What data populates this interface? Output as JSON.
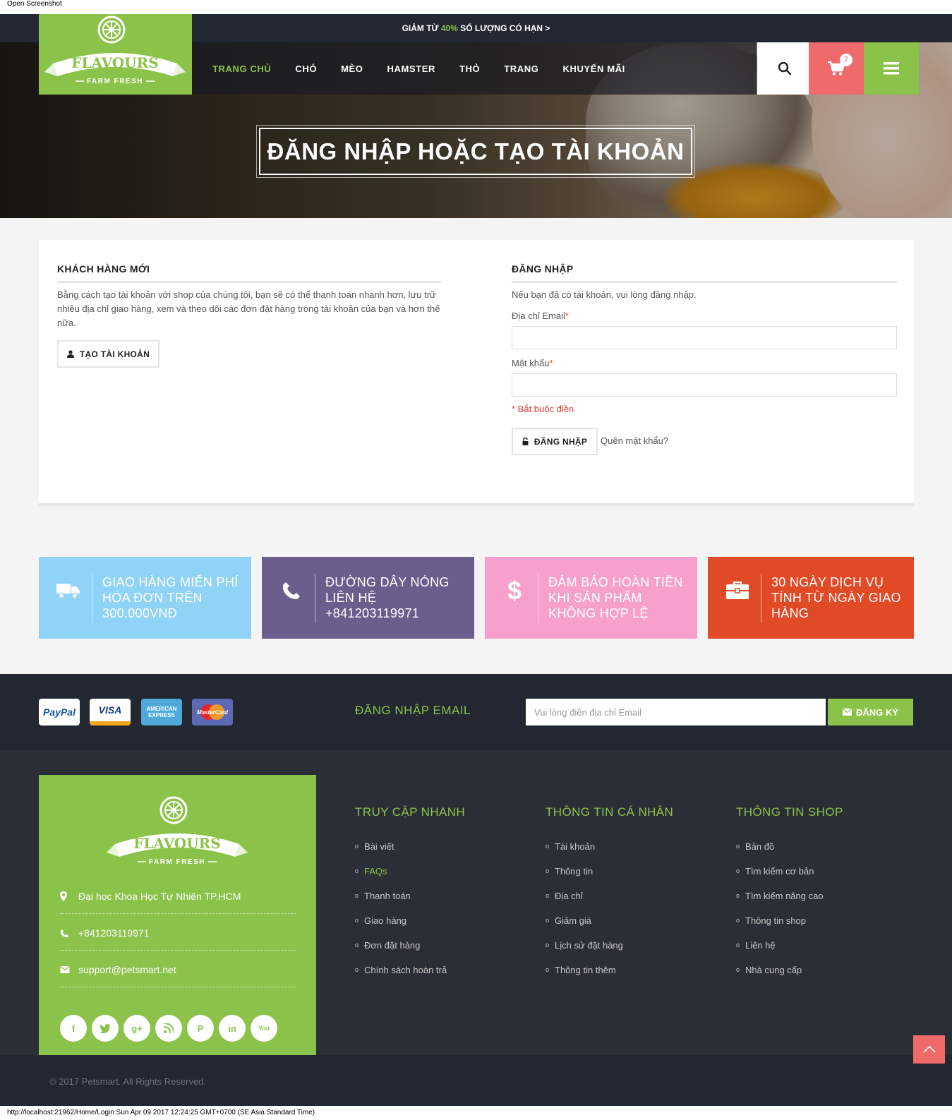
{
  "window": {
    "label": "Open Screenshot"
  },
  "promo": {
    "prefix": "GIẢM TỪ ",
    "highlight": "40%",
    "suffix": " SỐ LƯỢNG CÓ HẠN >"
  },
  "logo": {
    "brand": "FLAVOURS",
    "tagline": "FARM FRESH"
  },
  "nav": {
    "items": [
      {
        "label": "TRANG CHỦ",
        "active": true
      },
      {
        "label": "CHÓ"
      },
      {
        "label": "MÈO"
      },
      {
        "label": "HAMSTER"
      },
      {
        "label": "THỎ"
      },
      {
        "label": "TRANG"
      },
      {
        "label": "KHUYẾN MÃI"
      }
    ]
  },
  "cart": {
    "count": "2"
  },
  "hero": {
    "title": "ĐĂNG NHẬP HOẶC TẠO TÀI KHOẢN"
  },
  "new_customer": {
    "title": "KHÁCH HÀNG MỚI",
    "description": "Bằng cách tạo tài khoản với shop của chúng tôi, bạn sẽ có thể thanh toán nhanh hơn, lưu trữ nhiều địa chỉ giao hàng, xem và theo dõi các đơn đặt hàng trong tài khoản của bạn và hơn thế nữa.",
    "button": "TẠO TÀI KHOẢN"
  },
  "login": {
    "title": "ĐĂNG NHẬP",
    "intro": "Nếu bạn đã có tài khoản, vui lòng đăng nhập.",
    "email_label": "Địa chỉ Email",
    "email_value": "",
    "password_label": "Mật khẩu",
    "password_value": "",
    "required_mark": "*",
    "required_note": "* Bắt buộc điền",
    "button": "ĐĂNG NHẬP",
    "forgot": "Quên mật khẩu?"
  },
  "features": [
    {
      "icon": "truck-icon",
      "text": "GIAO HÀNG MIỄN PHÍ HÓA ĐƠN TRÊN 300.000VNĐ",
      "color": "#8fd3f7"
    },
    {
      "icon": "phone-icon",
      "text": "ĐƯỜNG DÂY NÓNG LIÊN HỆ +841203119971",
      "color": "#6a5f8c"
    },
    {
      "icon": "dollar-icon",
      "text": "ĐẢM BẢO HOÀN TIỀN KHI SẢN PHẨM KHÔNG HỢP LỆ",
      "color": "#f7a0cc"
    },
    {
      "icon": "briefcase-icon",
      "text": "30 NGÀY DỊCH VỤ TÍNH TỪ NGÀY GIAO HÀNG",
      "color": "#e14a26"
    }
  ],
  "payments": [
    "PayPal",
    "VISA",
    "AMERICAN EXPRESS",
    "MasterCard"
  ],
  "newsletter": {
    "title": "ĐĂNG NHẬP EMAIL",
    "placeholder": "Vui lòng điền địa chỉ Email",
    "button": "ĐĂNG KÝ"
  },
  "footer": {
    "address": "Đại học Khoa Học Tự Nhiên TP.HCM",
    "phone": "+841203119971",
    "email": "support@petsmart.net",
    "socials": [
      "facebook-icon",
      "twitter-icon",
      "google-plus-icon",
      "rss-icon",
      "pinterest-icon",
      "linkedin-icon",
      "youtube-icon"
    ],
    "columns": [
      {
        "title": "TRUY CẬP NHANH",
        "items": [
          "Bài viết",
          "FAQs",
          "Thanh toán",
          "Giao hàng",
          "Đơn đặt hàng",
          "Chính sách hoàn trả"
        ]
      },
      {
        "title": "THÔNG TIN CÁ NHÂN",
        "items": [
          "Tài khoản",
          "Thông tin",
          "Địa chỉ",
          "Giảm giá",
          "Lịch sử đặt hàng",
          "Thông tin thêm"
        ]
      },
      {
        "title": "THÔNG TIN SHOP",
        "items": [
          "Bản đồ",
          "Tìm kiếm cơ bản",
          "Tìm kiếm nâng cao",
          "Thông tin shop",
          "Liên hệ",
          "Nhà cung cấp"
        ]
      }
    ],
    "copyright": "© 2017 Petsmart. All Rights Reserved."
  },
  "status_bar": "http://localhost:21962/Home/Login Sun Apr 09 2017 12:24:25 GMT+0700 (SE Asia Standard Time)"
}
